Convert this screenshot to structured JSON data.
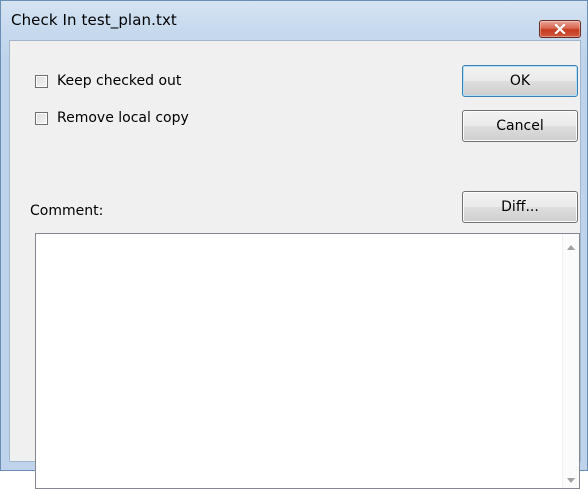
{
  "window": {
    "title": "Check In test_plan.txt"
  },
  "options": {
    "keep_checked_out": {
      "label": "Keep checked out",
      "checked": false
    },
    "remove_local_copy": {
      "label": "Remove local copy",
      "checked": false
    }
  },
  "buttons": {
    "ok": "OK",
    "cancel": "Cancel",
    "diff": "Diff..."
  },
  "comment": {
    "label": "Comment:",
    "value": ""
  },
  "icons": {
    "close": "close-icon",
    "scroll_up": "scroll-up-arrow-icon",
    "scroll_down": "scroll-down-arrow-icon"
  },
  "colors": {
    "close_button": "#c94a31",
    "titlebar": "#c6d9ee",
    "client_background": "#f0f0f0"
  }
}
